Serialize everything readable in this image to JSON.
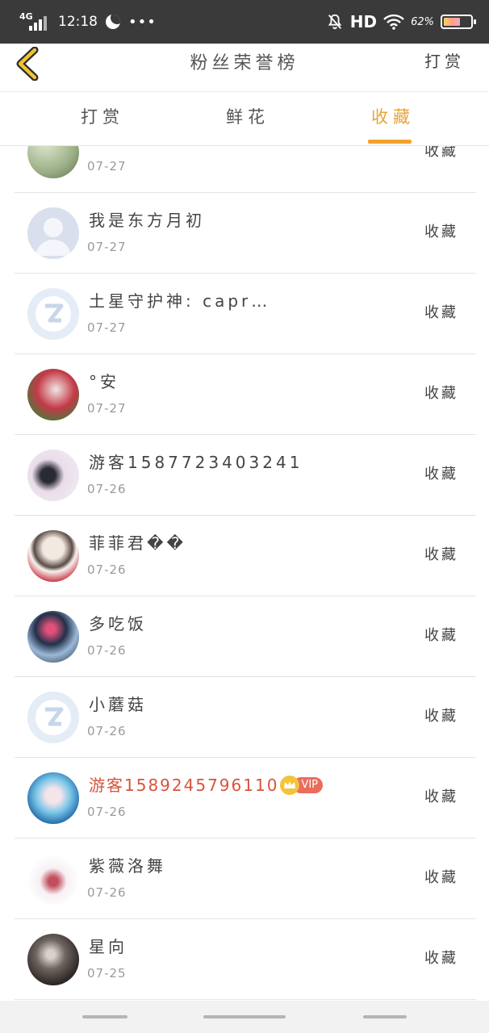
{
  "status_bar": {
    "network": "4G",
    "time": "12:18",
    "dots": "•••",
    "hd": "HD",
    "battery_pct": "62%",
    "battery_level": 0.62
  },
  "header": {
    "title": "粉丝荣誉榜",
    "action": "打赏"
  },
  "tabs": [
    {
      "label": "打赏",
      "active": false
    },
    {
      "label": "鲜花",
      "active": false
    },
    {
      "label": "收藏",
      "active": true
    }
  ],
  "colors": {
    "accent": "#f0a32c",
    "vip_name": "#d9533a",
    "status_bar_bg": "#3a3a3a"
  },
  "list": [
    {
      "name": "",
      "date": "07-27",
      "action": "收藏",
      "avatar": "photo-green"
    },
    {
      "name": "我是东方月初",
      "date": "07-27",
      "action": "收藏",
      "avatar": "default-person"
    },
    {
      "name": "土星守护神: capr…",
      "date": "07-27",
      "action": "收藏",
      "avatar": "qq-logo"
    },
    {
      "name": "°安",
      "date": "07-27",
      "action": "收藏",
      "avatar": "photo-girl-red"
    },
    {
      "name": "游客1587723403241",
      "date": "07-26",
      "action": "收藏",
      "avatar": "photo-anime-dark"
    },
    {
      "name": "菲菲君��",
      "date": "07-26",
      "action": "收藏",
      "avatar": "photo-anime-girl"
    },
    {
      "name": "多吃饭",
      "date": "07-26",
      "action": "收藏",
      "avatar": "photo-boy-neon"
    },
    {
      "name": "小蘑菇",
      "date": "07-26",
      "action": "收藏",
      "avatar": "qq-logo"
    },
    {
      "name": "游客1589245796110",
      "date": "07-26",
      "action": "收藏",
      "avatar": "photo-anime-blue",
      "vip": true,
      "vip_label": "VIP"
    },
    {
      "name": "紫薇洛舞",
      "date": "07-26",
      "action": "收藏",
      "avatar": "photo-chibi"
    },
    {
      "name": "星向",
      "date": "07-25",
      "action": "收藏",
      "avatar": "photo-dark"
    }
  ]
}
